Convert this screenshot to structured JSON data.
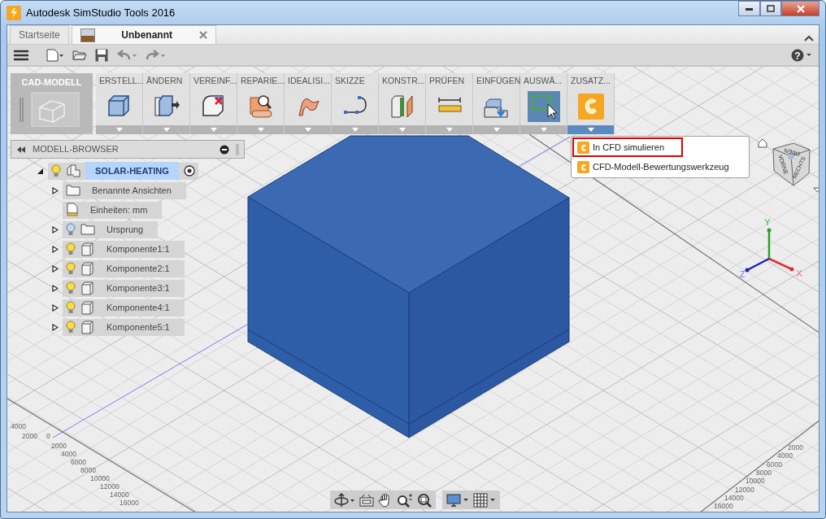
{
  "window": {
    "title": "Autodesk SimStudio Tools 2016"
  },
  "toolbar": {
    "help": "?"
  },
  "tabs": [
    {
      "label": "Startseite",
      "selected": false
    },
    {
      "label": "Unbenannt",
      "selected": true
    }
  ],
  "ribbon": {
    "workspace": "CAD-MODELL",
    "groups": [
      {
        "label": "ERSTELL...",
        "active": false,
        "expanded": false
      },
      {
        "label": "ÄNDERN",
        "active": false,
        "expanded": false
      },
      {
        "label": "VEREINF...",
        "active": false,
        "expanded": false
      },
      {
        "label": "REPARIE...",
        "active": false,
        "expanded": false
      },
      {
        "label": "IDEALISI...",
        "active": false,
        "expanded": false
      },
      {
        "label": "SKIZZE",
        "active": false,
        "expanded": false
      },
      {
        "label": "KONSTR...",
        "active": false,
        "expanded": false
      },
      {
        "label": "PRÜFEN",
        "active": false,
        "expanded": false
      },
      {
        "label": "EINFÜGEN",
        "active": false,
        "expanded": false
      },
      {
        "label": "AUSWÄ...",
        "active": true,
        "expanded": false
      },
      {
        "label": "ZUSATZ...",
        "active": false,
        "expanded": true
      }
    ]
  },
  "menu": {
    "items": [
      {
        "label": "In CFD simulieren",
        "highlighted": true
      },
      {
        "label": "CFD-Modell-Bewertungswerkzeug",
        "highlighted": false
      }
    ]
  },
  "browser": {
    "title": "MODELL-BROWSER",
    "tree": {
      "label": "SOLAR-HEATING",
      "kind": "root",
      "selected": true,
      "expanded": true,
      "lit": true,
      "children": [
        {
          "label": "Benannte Ansichten",
          "kind": "folder",
          "expanded": false
        },
        {
          "label": "Einheiten: mm",
          "kind": "units"
        },
        {
          "label": "Ursprung",
          "kind": "folder",
          "expanded": false,
          "lit": false
        },
        {
          "label": "Komponente1:1",
          "kind": "component",
          "expanded": false,
          "lit": true
        },
        {
          "label": "Komponente2:1",
          "kind": "component",
          "expanded": false,
          "lit": true
        },
        {
          "label": "Komponente3:1",
          "kind": "component",
          "expanded": false,
          "lit": true
        },
        {
          "label": "Komponente4:1",
          "kind": "component",
          "expanded": false,
          "lit": true
        },
        {
          "label": "Komponente5:1",
          "kind": "component",
          "expanded": false,
          "lit": true
        }
      ]
    }
  },
  "view_cube": {
    "faces": [
      "OBEN",
      "VORNE",
      "RECHTS"
    ]
  },
  "triad": {
    "axes": [
      "Y",
      "X",
      "Z"
    ]
  },
  "grid_labels": {
    "left_axis": [
      "4000",
      "2000",
      "0",
      "2000",
      "4000",
      "6000",
      "8000",
      "10000",
      "12000",
      "14000",
      "16000"
    ],
    "right_axis": [
      "2000",
      "4000",
      "6000",
      "8000",
      "10000",
      "12000",
      "14000",
      "16000"
    ]
  }
}
